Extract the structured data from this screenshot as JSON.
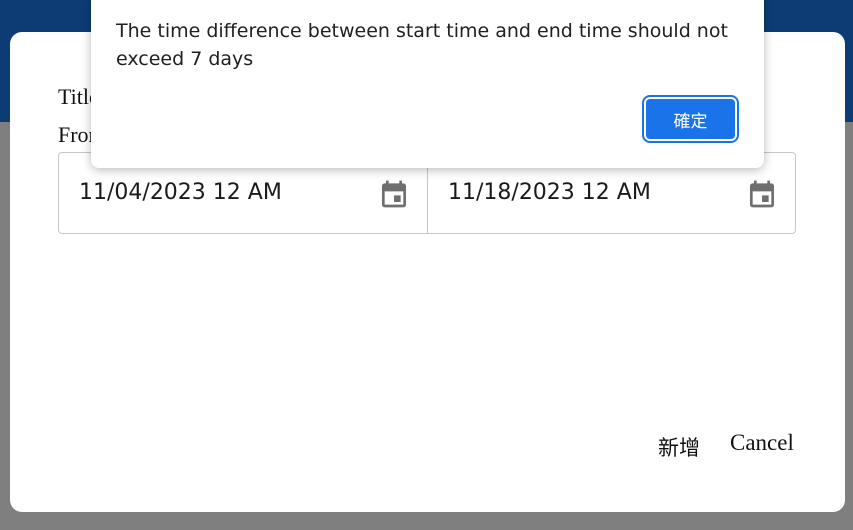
{
  "form": {
    "title_label": "Title",
    "from_label": "From",
    "start_date": "11/04/2023 12 AM",
    "end_date": "11/18/2023 12 AM",
    "add_label": "新增",
    "cancel_label": "Cancel"
  },
  "alert": {
    "message": "The time difference between start time and end time should not exceed 7 days",
    "ok_label": "確定"
  },
  "icons": {
    "calendar": "calendar-icon"
  },
  "colors": {
    "header": "#0d3c75",
    "overlay": "#7f7f7f",
    "primary_button": "#1a73e8"
  }
}
